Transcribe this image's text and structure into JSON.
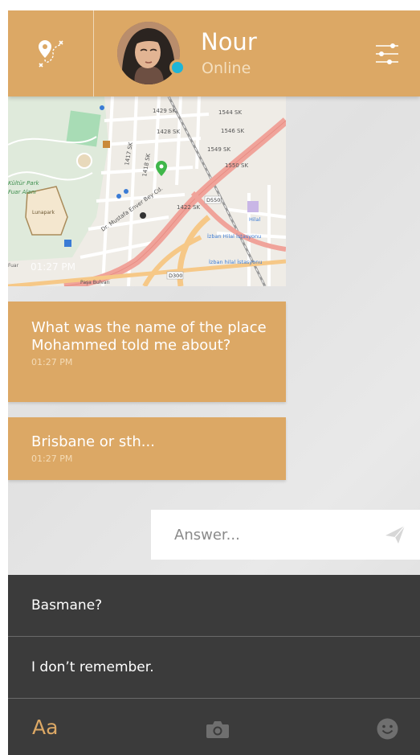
{
  "header": {
    "contact_name": "Nour",
    "contact_status": "Online",
    "route_icon": "map-route-icon",
    "filter_icon": "sliders-icon"
  },
  "colors": {
    "accent": "#dca865",
    "online": "#1fb5d6",
    "panel": "#3b3b3b"
  },
  "map": {
    "time": "01:27 PM",
    "labels": {
      "kultur_park": "Kültür Park",
      "fuar_alani": "Fuar Alanı",
      "lunapark": "Lunapark",
      "d550": "D550",
      "d300": "D300",
      "izban": "İzban Hilal İstasyonu",
      "izban2": "İzban hilal İstasyonu",
      "hilal": "Hilal",
      "sk1429": "1429 SK",
      "sk1428": "1428 SK",
      "sk1422": "1422 SK",
      "sk1417": "1417 SK",
      "sk1418": "1418 SK",
      "sk1544": "1544 SK",
      "sk1546": "1546 SK",
      "sk1549": "1549 SK",
      "sk1550": "1550 SK",
      "fuar": "Fuar",
      "pasa": "Paşa Bulvarı",
      "mustafa": "Dr. Mustafa Enver Bey Cd."
    }
  },
  "messages": [
    {
      "text": "What was the name of the place Mohammed told me about?",
      "time": "01:27 PM"
    },
    {
      "text": "Brisbane or sth...",
      "time": "01:27 PM"
    }
  ],
  "answer": {
    "placeholder": "Answer...",
    "send_icon": "send-icon"
  },
  "suggestions": [
    {
      "label": "Basmane?"
    },
    {
      "label": "I don’t remember."
    }
  ],
  "toolbar": {
    "font_label": "Aa",
    "camera_icon": "camera-icon",
    "emoji_icon": "emoji-icon"
  }
}
